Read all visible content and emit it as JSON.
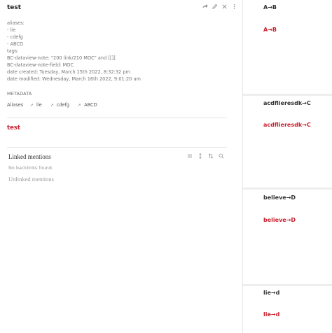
{
  "note": {
    "title": "test",
    "frontmatter": [
      "aliases:",
      "- lie",
      "- cdefg",
      "- ABCD",
      "tags:",
      "BC-dataview-note: \"200 link/210 MOC\" and [[]]",
      "BC-dataview-note-field: MOC",
      "date created: Tuesday, March 15th 2022, 8:32:32 pm",
      "date modified: Wednesday, March 16th 2022, 9:01:20 am"
    ],
    "metadata_heading": "METADATA",
    "aliases_key": "Aliases",
    "aliases": [
      "lie",
      "cdefg",
      "ABCD"
    ],
    "link_text": "test"
  },
  "backlinks": {
    "title": "Linked mentions",
    "empty_text": "No backlinks found.",
    "unlinked_title": "Unlinked mentions"
  },
  "right_panes": [
    {
      "title": "A→B",
      "link": "A→B"
    },
    {
      "title": "acdflieresdk→C",
      "link": "acdflieresdk→C"
    },
    {
      "title": "believe→D",
      "link": "believe→D"
    },
    {
      "title": "lie→d",
      "link": "lie→d"
    }
  ],
  "colors": {
    "accent": "#c8202f",
    "text": "#333333",
    "muted": "#999999"
  },
  "icons": [
    "share-icon",
    "edit-icon",
    "close-icon",
    "more-icon",
    "list-icon",
    "collapse-icon",
    "sort-icon",
    "search-icon",
    "link-icon"
  ]
}
